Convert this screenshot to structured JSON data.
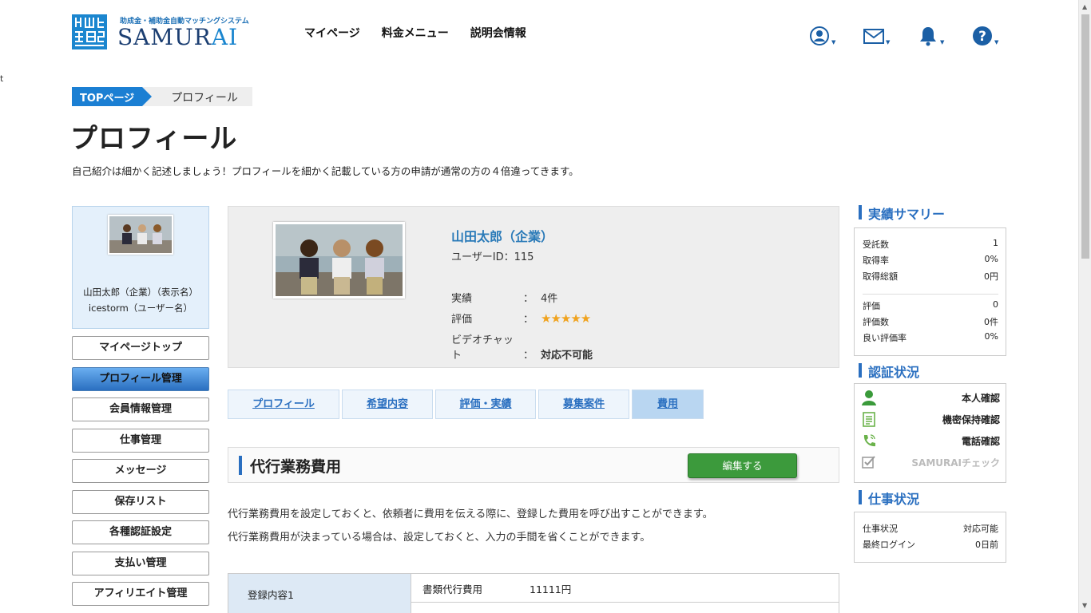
{
  "header": {
    "logo_tagline": "助成金・補助金自動マッチングシステム",
    "logo_word_a": "SAMUR",
    "logo_word_b": "AI",
    "nav": [
      "マイページ",
      "料金メニュー",
      "説明会情報"
    ],
    "icons": [
      "user-icon",
      "mail-icon",
      "bell-icon",
      "help-icon"
    ],
    "brand_color": "#1c3f72",
    "accent_color": "#1b86cf"
  },
  "stray_text": "t",
  "breadcrumb": {
    "top": "TOPページ",
    "current": "プロフィール"
  },
  "page_title": "プロフィール",
  "intro": "自己紹介は細かく記述しましょう！プロフィールを細かく記載している方の申請が通常の方の４倍違ってきます。",
  "sidebar": {
    "display_name": "山田太郎（企業）（表示名）",
    "user_name": "icestorm（ユーザー名）",
    "menu": [
      "マイページトップ",
      "プロフィール管理",
      "会員情報管理",
      "仕事管理",
      "メッセージ",
      "保存リスト",
      "各種認証設定",
      "支払い管理",
      "アフィリエイト管理"
    ],
    "active_index": 1
  },
  "profile": {
    "name": "山田太郎（企業）",
    "user_id": "ユーザーID：115",
    "rows": [
      {
        "label": "実績",
        "colon": "：",
        "value": "4件"
      },
      {
        "label": "評価",
        "colon": "：",
        "value": "★★★★★",
        "stars": 5
      },
      {
        "label": "ビデオチャット",
        "colon": "：",
        "value": "対応不可能"
      }
    ]
  },
  "tabs": [
    "プロフィール",
    "希望内容",
    "評価・実績",
    "募集案件",
    "費用"
  ],
  "active_tab": 4,
  "section": {
    "title": "代行業務費用",
    "edit_label": "編集する",
    "desc1": "代行業務費用を設定しておくと、依頼者に費用を伝える際に、登録した費用を呼び出すことができます。",
    "desc2": "代行業務費用が決まっている場合は、設定しておくと、入力の手間を省くことができます。"
  },
  "registration": {
    "head": "登録内容1",
    "key": "書類代行費用",
    "value": "11111円"
  },
  "summary": {
    "title": "実績サマリー",
    "rows1": [
      {
        "label": "受託数",
        "value": "1"
      },
      {
        "label": "取得率",
        "value": "0%"
      },
      {
        "label": "取得総額",
        "value": "0円"
      }
    ],
    "rows2": [
      {
        "label": "評価",
        "value": "0"
      },
      {
        "label": "評価数",
        "value": "0件"
      },
      {
        "label": "良い評価率",
        "value": "0%"
      }
    ]
  },
  "auth": {
    "title": "認証状況",
    "items": [
      {
        "label": "本人確認",
        "icon": "person-icon",
        "active": true
      },
      {
        "label": "機密保持確認",
        "icon": "document-icon",
        "active": true
      },
      {
        "label": "電話確認",
        "icon": "phone-icon",
        "active": true
      },
      {
        "label": "SAMURAIチェック",
        "icon": "check-icon",
        "active": false
      }
    ]
  },
  "work": {
    "title": "仕事状況",
    "rows": [
      {
        "label": "仕事状況",
        "value": "対応可能"
      },
      {
        "label": "最終ログイン",
        "value": "0日前"
      }
    ]
  }
}
